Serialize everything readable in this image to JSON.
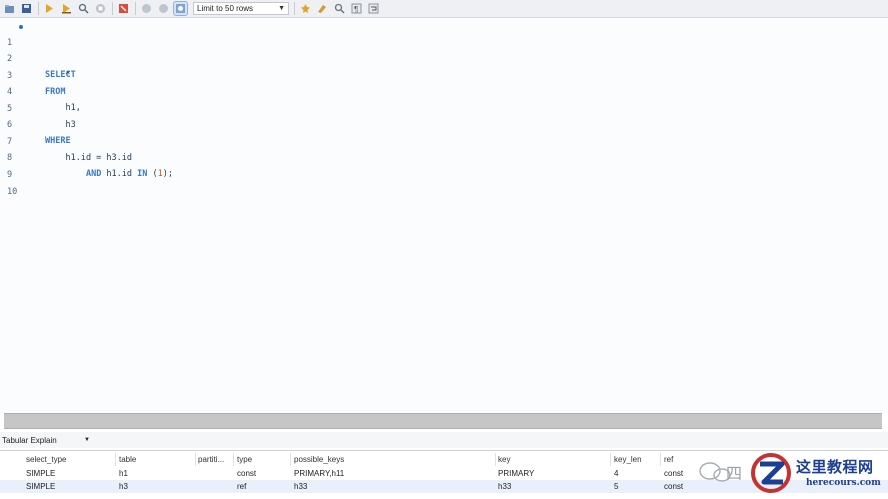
{
  "toolbar": {
    "limit_label": "Limit to 50 rows",
    "icons": [
      "open-file-icon",
      "save-icon",
      "execute-icon",
      "execute-current-icon",
      "explain-icon",
      "stop-icon",
      "error-toggle-icon",
      "commit-icon",
      "rollback-icon",
      "autocommit-icon",
      "beautify-icon",
      "find-icon",
      "invisible-chars-icon",
      "wrap-icon"
    ]
  },
  "editor": {
    "lines": [
      {
        "n": "1",
        "text": "SELECT",
        "marker": true
      },
      {
        "n": "2",
        "text": "    *"
      },
      {
        "n": "3",
        "text": "FROM"
      },
      {
        "n": "4",
        "text": "    h1,"
      },
      {
        "n": "5",
        "text": "    h3"
      },
      {
        "n": "6",
        "text": "WHERE"
      },
      {
        "n": "7",
        "text": "    h1.id = h3.id"
      },
      {
        "n": "8",
        "text": "        AND h1.id IN (1);"
      },
      {
        "n": "9",
        "text": ""
      },
      {
        "n": "10",
        "text": ""
      }
    ]
  },
  "result": {
    "view_label": "Tabular Explain",
    "columns": [
      "select_type",
      "table",
      "partiti...",
      "type",
      "possible_keys",
      "key",
      "key_len",
      "ref"
    ],
    "rows": [
      [
        "SIMPLE",
        "h1",
        "",
        "const",
        "PRIMARY,h11",
        "PRIMARY",
        "4",
        "const"
      ],
      [
        "SIMPLE",
        "h3",
        "",
        "ref",
        "h33",
        "h33",
        "5",
        "const"
      ]
    ]
  },
  "watermark": {
    "title": "这里教程网",
    "url": "herecours.com",
    "partial": "四"
  },
  "colors": {
    "keyword": "#3778c7",
    "identifier": "#1f3a5a",
    "literal": "#c25b1b",
    "line_number": "#4d6b8a",
    "selected_row": "#e9f0fb"
  }
}
